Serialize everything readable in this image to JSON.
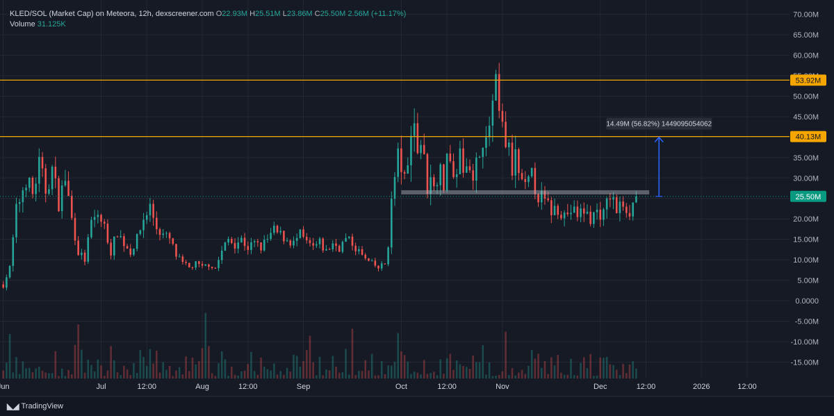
{
  "legend": {
    "symbol": "KLED/SOL (Market Cap) on Meteora, 12h, dexscreener.com",
    "o_key": "O",
    "o_val": "22.93M",
    "h_key": "H",
    "h_val": "25.51M",
    "l_key": "L",
    "l_val": "23.86M",
    "c_key": "C",
    "c_val": "25.50M",
    "change": "2.56M (+11.17%)",
    "volume_label": "Volume",
    "volume_val": "31.125K"
  },
  "footer": {
    "brand": "TradingView"
  },
  "colors": {
    "up": "#26a69a",
    "down": "#ef5350",
    "level": "#f7a600",
    "current": "#089981",
    "measure": "#2962ff",
    "grid": "#242832"
  },
  "chart_data": {
    "type": "candlestick",
    "y_ticks": [
      "70.00M",
      "65.00M",
      "60.00M",
      "55.00M",
      "50.00M",
      "45.00M",
      "40.00M",
      "35.00M",
      "30.00M",
      "25.00M",
      "20.00M",
      "15.00M",
      "10.00M",
      "5.00M",
      "0.0000",
      "-5.00M",
      "-10.00M",
      "-15.00M"
    ],
    "y_tick_values": [
      70,
      65,
      60,
      55,
      50,
      45,
      40,
      35,
      30,
      25,
      20,
      15,
      10,
      5,
      0,
      -5,
      -10,
      -15
    ],
    "ylim": [
      -19,
      73.5
    ],
    "x_ticks": [
      {
        "label": "Jun",
        "t": 0
      },
      {
        "label": "Jul",
        "t": 30
      },
      {
        "label": "12:00",
        "t": 44
      },
      {
        "label": "Aug",
        "t": 61
      },
      {
        "label": "12:00",
        "t": 75
      },
      {
        "label": "Sep",
        "t": 92
      },
      {
        "label": "Oct",
        "t": 122
      },
      {
        "label": "12:00",
        "t": 136
      },
      {
        "label": "Nov",
        "t": 153
      },
      {
        "label": "Dec",
        "t": 183
      },
      {
        "label": "12:00",
        "t": 197
      },
      {
        "label": "2026",
        "t": 214
      },
      {
        "label": "12:00",
        "t": 228
      }
    ],
    "xlim": [
      -1,
      241
    ],
    "last_t": 194,
    "horizontal_levels": [
      {
        "label": "53.92M",
        "value": 53.92
      },
      {
        "label": "40.13M",
        "value": 40.13
      }
    ],
    "current_price": {
      "label": "25.50M",
      "value": 25.5
    },
    "support_zone": {
      "t_start": 122,
      "t_end": 198,
      "value": 26.5
    },
    "measure": {
      "t": 201,
      "from": 25.5,
      "to": 40.13,
      "label": "14.49M (56.82%) 1449095054062"
    },
    "anchors": [
      [
        0,
        4
      ],
      [
        2,
        8
      ],
      [
        4,
        22
      ],
      [
        7,
        30
      ],
      [
        9,
        26
      ],
      [
        11,
        33
      ],
      [
        13,
        27
      ],
      [
        15,
        32
      ],
      [
        17,
        24
      ],
      [
        19,
        30
      ],
      [
        21,
        20
      ],
      [
        23,
        12
      ],
      [
        25,
        10
      ],
      [
        27,
        19
      ],
      [
        29,
        21
      ],
      [
        31,
        18
      ],
      [
        33,
        12
      ],
      [
        35,
        17
      ],
      [
        37,
        14
      ],
      [
        39,
        12
      ],
      [
        41,
        15
      ],
      [
        43,
        20
      ],
      [
        45,
        23
      ],
      [
        47,
        18
      ],
      [
        49,
        16
      ],
      [
        51,
        15
      ],
      [
        53,
        11
      ],
      [
        55,
        9
      ],
      [
        57,
        8
      ],
      [
        59,
        9
      ],
      [
        61,
        8
      ],
      [
        63,
        9
      ],
      [
        65,
        8
      ],
      [
        67,
        12
      ],
      [
        69,
        15
      ],
      [
        71,
        14
      ],
      [
        73,
        15
      ],
      [
        75,
        13
      ],
      [
        77,
        14
      ],
      [
        79,
        13
      ],
      [
        81,
        15
      ],
      [
        83,
        17
      ],
      [
        85,
        16
      ],
      [
        87,
        15
      ],
      [
        89,
        14
      ],
      [
        91,
        16
      ],
      [
        93,
        14
      ],
      [
        95,
        13
      ],
      [
        97,
        14
      ],
      [
        99,
        12
      ],
      [
        101,
        14
      ],
      [
        103,
        13
      ],
      [
        105,
        15
      ],
      [
        107,
        14
      ],
      [
        109,
        12
      ],
      [
        111,
        10
      ],
      [
        113,
        9
      ],
      [
        115,
        8
      ],
      [
        117,
        9
      ],
      [
        118,
        14
      ],
      [
        119,
        24
      ],
      [
        120,
        30
      ],
      [
        121,
        35
      ],
      [
        122,
        33
      ],
      [
        123,
        29
      ],
      [
        124,
        32
      ],
      [
        125,
        44
      ],
      [
        126,
        43
      ],
      [
        127,
        37
      ],
      [
        128,
        39
      ],
      [
        129,
        34
      ],
      [
        130,
        28
      ],
      [
        131,
        32
      ],
      [
        132,
        27
      ],
      [
        133,
        31
      ],
      [
        134,
        36
      ],
      [
        135,
        25
      ],
      [
        136,
        38
      ],
      [
        137,
        34
      ],
      [
        138,
        28
      ],
      [
        139,
        33
      ],
      [
        140,
        35
      ],
      [
        141,
        30
      ],
      [
        142,
        36
      ],
      [
        143,
        34
      ],
      [
        144,
        28
      ],
      [
        145,
        33
      ],
      [
        146,
        38
      ],
      [
        147,
        41
      ],
      [
        148,
        37
      ],
      [
        149,
        43
      ],
      [
        150,
        47
      ],
      [
        151,
        51
      ],
      [
        152,
        45
      ],
      [
        153,
        41
      ],
      [
        154,
        39
      ],
      [
        155,
        36
      ],
      [
        156,
        32
      ],
      [
        157,
        35
      ],
      [
        158,
        31
      ],
      [
        159,
        28
      ],
      [
        160,
        27
      ],
      [
        162,
        30
      ],
      [
        164,
        26
      ],
      [
        166,
        24
      ],
      [
        168,
        22
      ],
      [
        170,
        23
      ],
      [
        172,
        21
      ],
      [
        174,
        22
      ],
      [
        176,
        21
      ],
      [
        178,
        22
      ],
      [
        180,
        20
      ],
      [
        182,
        22
      ],
      [
        184,
        21
      ],
      [
        186,
        26
      ],
      [
        188,
        22
      ],
      [
        190,
        24
      ],
      [
        192,
        22
      ],
      [
        194,
        25.5
      ]
    ],
    "volume_max": 16.0
  }
}
